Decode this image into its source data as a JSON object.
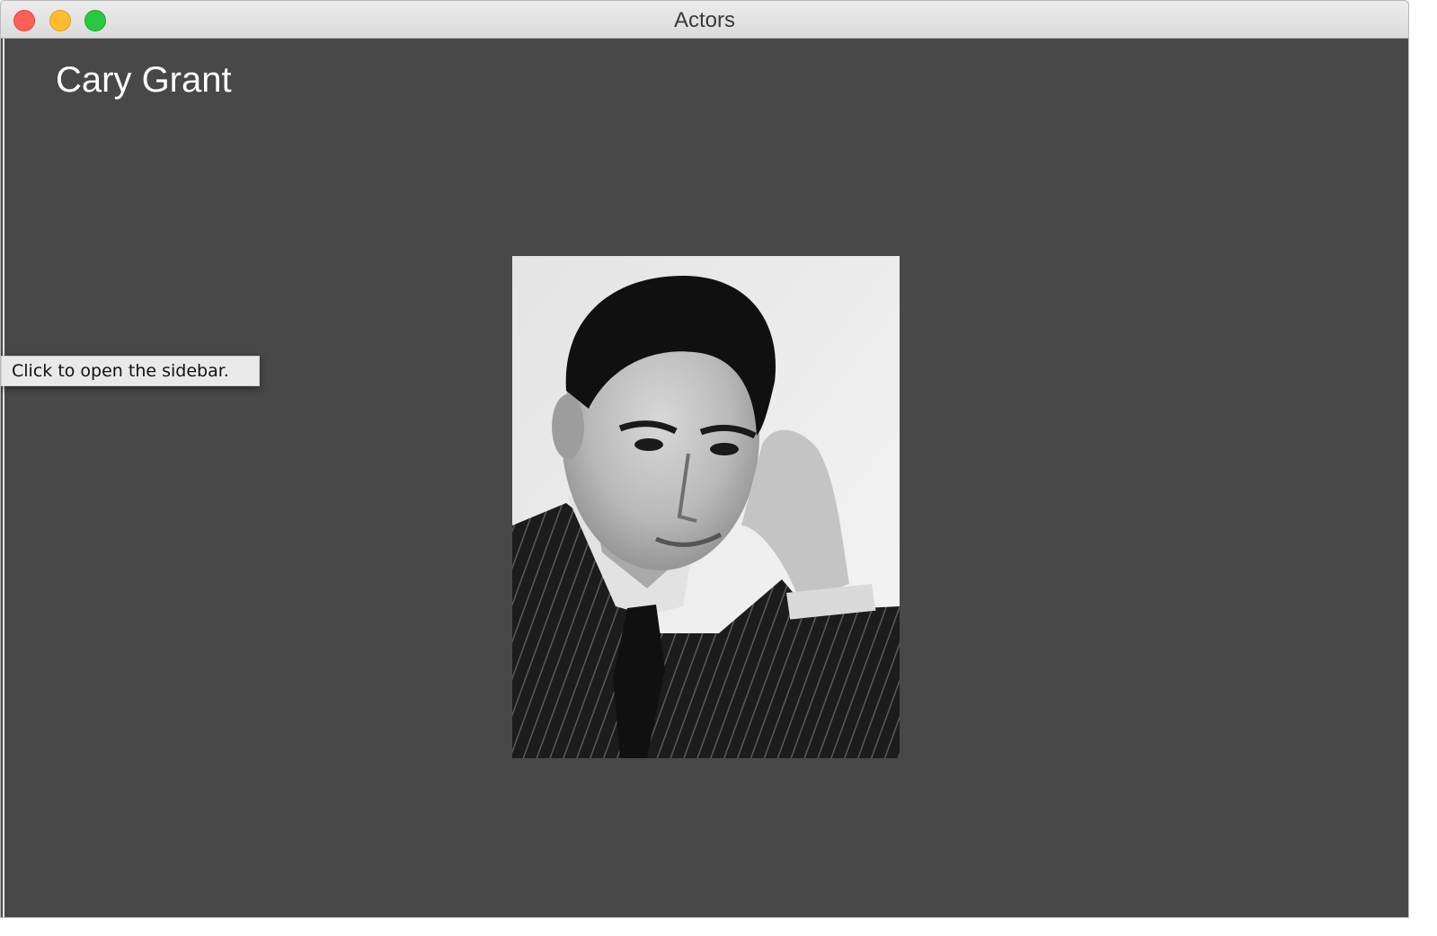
{
  "window": {
    "title": "Actors"
  },
  "main": {
    "actor_name": "Cary Grant",
    "sidebar_tooltip": "Click to open the sidebar.",
    "portrait_alt": "Cary Grant"
  },
  "colors": {
    "content_background": "#484848",
    "title_text": "#ffffff",
    "close": "#fe5f57",
    "minimize": "#febc2e",
    "maximize": "#28c840"
  },
  "icons": [
    "close-icon",
    "minimize-icon",
    "maximize-icon"
  ]
}
